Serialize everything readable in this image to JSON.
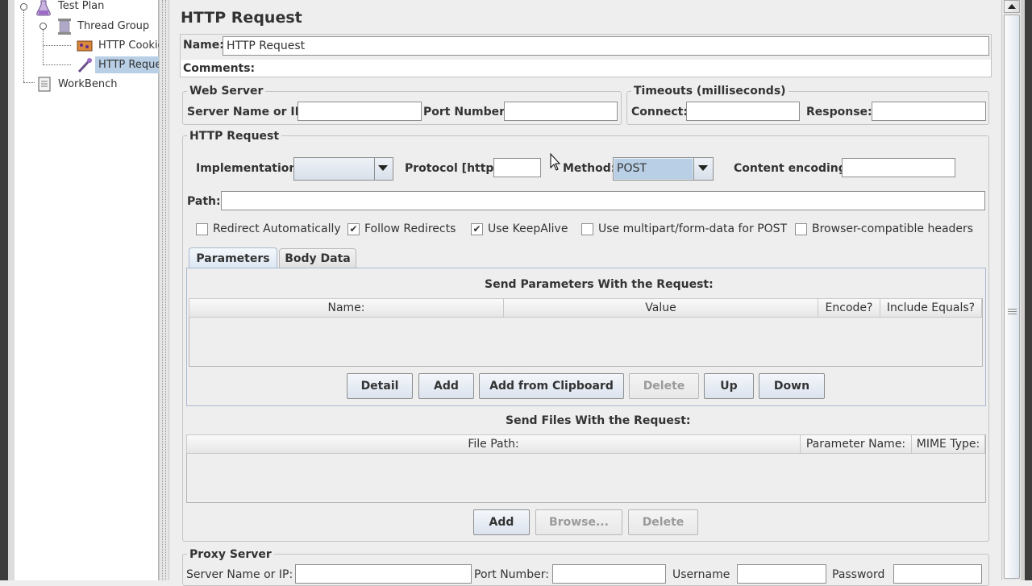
{
  "tree": {
    "items": [
      {
        "label": "Test Plan"
      },
      {
        "label": "Thread Group"
      },
      {
        "label": "HTTP Cookie"
      },
      {
        "label": "HTTP Reque"
      },
      {
        "label": "WorkBench"
      }
    ]
  },
  "panel": {
    "title": "HTTP Request",
    "name_label": "Name:",
    "name_value": "HTTP Request",
    "comments_label": "Comments:"
  },
  "web_server": {
    "title": "Web Server",
    "server_label": "Server Name or IP:",
    "port_label": "Port Number:"
  },
  "timeouts": {
    "title": "Timeouts (milliseconds)",
    "connect_label": "Connect:",
    "response_label": "Response:"
  },
  "http_request": {
    "title": "HTTP Request",
    "implementation_label": "Implementation:",
    "protocol_label": "Protocol [http]:",
    "method_label": "Method:",
    "method_value": "POST",
    "encoding_label": "Content encoding:",
    "path_label": "Path:"
  },
  "options": {
    "redirect_auto": "Redirect Automatically",
    "follow_redirects": "Follow Redirects",
    "keepalive": "Use KeepAlive",
    "multipart": "Use multipart/form-data for POST",
    "browser_headers": "Browser-compatible headers"
  },
  "tabs": {
    "parameters": "Parameters",
    "body_data": "Body Data"
  },
  "params": {
    "title": "Send Parameters With the Request:",
    "columns": [
      "Name:",
      "Value",
      "Encode?",
      "Include Equals?"
    ],
    "buttons": {
      "detail": "Detail",
      "add": "Add",
      "add_clipboard": "Add from Clipboard",
      "delete": "Delete",
      "up": "Up",
      "down": "Down"
    }
  },
  "files": {
    "title": "Send Files With the Request:",
    "columns": [
      "File Path:",
      "Parameter Name:",
      "MIME Type:"
    ],
    "buttons": {
      "add": "Add",
      "browse": "Browse...",
      "delete": "Delete"
    }
  },
  "proxy": {
    "title": "Proxy Server",
    "server_label": "Server Name or IP:",
    "port_label": "Port Number:",
    "username_label": "Username",
    "password_label": "Password"
  }
}
